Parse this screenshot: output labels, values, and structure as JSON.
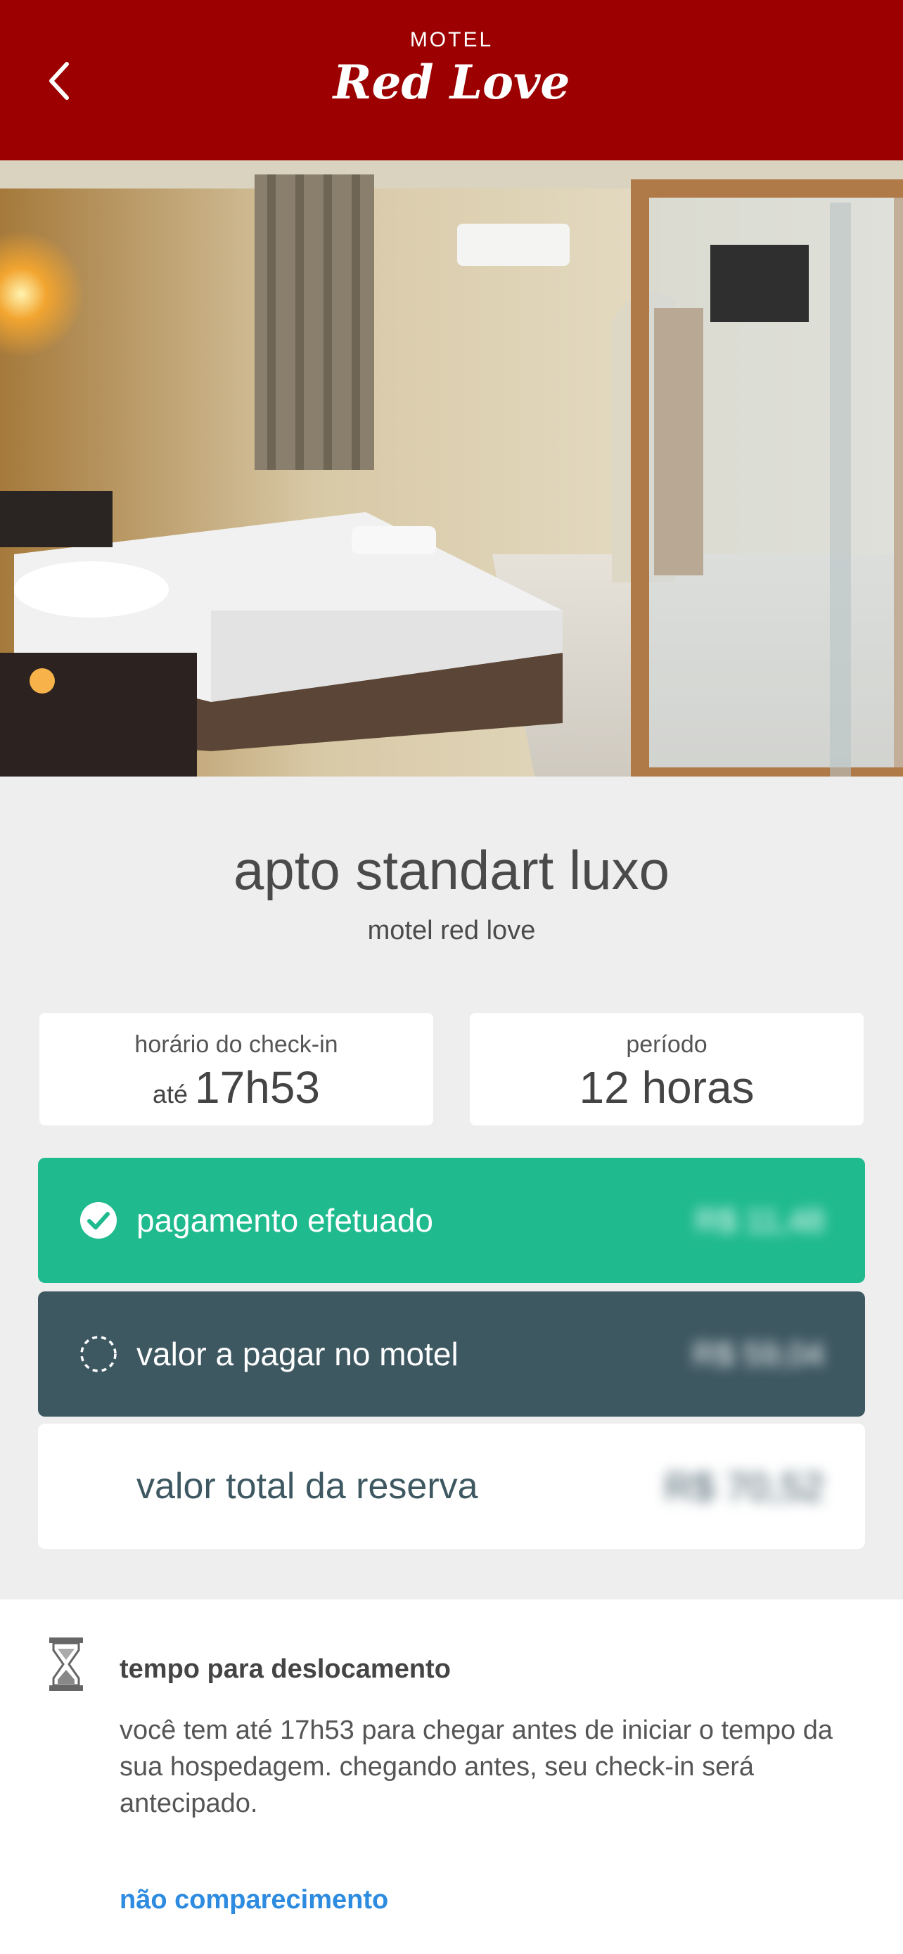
{
  "header": {
    "logo_small": "MOTEL",
    "logo_main": "Red Love"
  },
  "room": {
    "title": "apto standart luxo",
    "subtitle": "motel red love"
  },
  "checkin": {
    "label": "horário do check-in",
    "prefix": "até",
    "value": "17h53"
  },
  "period": {
    "label": "período",
    "value": "12 horas"
  },
  "payment": {
    "paid_label": "pagamento efetuado",
    "paid_amount": "R$ 11,48",
    "due_label": "valor a pagar no motel",
    "due_amount": "R$ 59,04",
    "total_label": "valor total da reserva",
    "total_amount": "R$ 70,52"
  },
  "travel": {
    "title": "tempo para deslocamento",
    "text": "você tem até 17h53 para chegar antes de iniciar o tempo da sua hospedagem. chegando antes, seu check-in será antecipado.",
    "link": "não comparecimento"
  },
  "colors": {
    "header": "#9c0000",
    "paid": "#1fba8e",
    "due": "#3e5862",
    "link": "#2d8be0"
  },
  "icons": [
    "back-arrow-icon",
    "check-circle-icon",
    "dashed-circle-icon",
    "hourglass-icon"
  ]
}
